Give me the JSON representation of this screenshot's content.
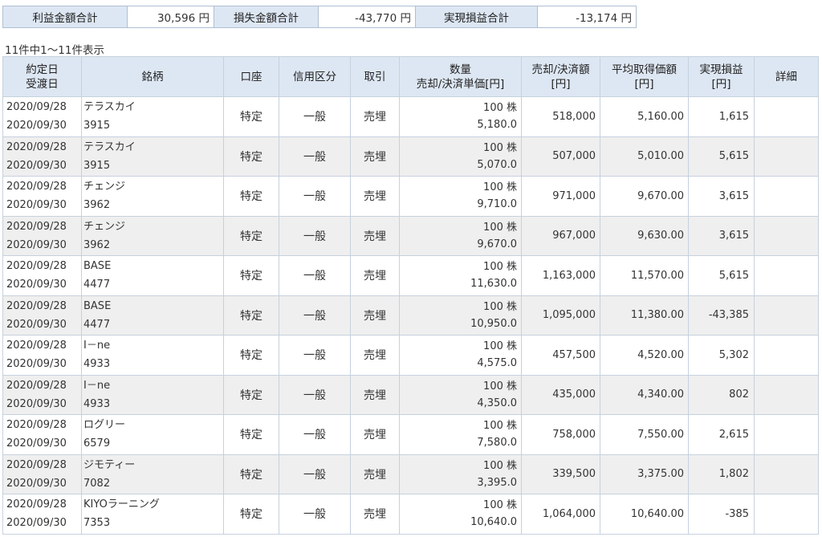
{
  "summary": {
    "profit_label": "利益金額合計",
    "profit_value": "30,596 円",
    "loss_label": "損失金額合計",
    "loss_value": "-43,770 円",
    "realized_label": "実現損益合計",
    "realized_value": "-13,174 円"
  },
  "count_text": "11件中1～11件表示",
  "headers": {
    "date": [
      "約定日",
      "受渡日"
    ],
    "brand": "銘柄",
    "account": "口座",
    "credit": "信用区分",
    "trade": "取引",
    "qty": [
      "数量",
      "売却/決済単価[円]"
    ],
    "amount": [
      "売却/決済額",
      "[円]"
    ],
    "avg": [
      "平均取得価額",
      "[円]"
    ],
    "pl": [
      "実現損益",
      "[円]"
    ],
    "detail": "詳細"
  },
  "rows": [
    {
      "trade_date": "2020/09/28",
      "settle_date": "2020/09/30",
      "name": "テラスカイ",
      "code": "3915",
      "account": "特定",
      "credit": "一般",
      "trade": "売埋",
      "qty": "100 株",
      "price": "5,180.0",
      "amount": "518,000",
      "avg": "5,160.00",
      "pl": "1,615"
    },
    {
      "trade_date": "2020/09/28",
      "settle_date": "2020/09/30",
      "name": "テラスカイ",
      "code": "3915",
      "account": "特定",
      "credit": "一般",
      "trade": "売埋",
      "qty": "100 株",
      "price": "5,070.0",
      "amount": "507,000",
      "avg": "5,010.00",
      "pl": "5,615"
    },
    {
      "trade_date": "2020/09/28",
      "settle_date": "2020/09/30",
      "name": "チェンジ",
      "code": "3962",
      "account": "特定",
      "credit": "一般",
      "trade": "売埋",
      "qty": "100 株",
      "price": "9,710.0",
      "amount": "971,000",
      "avg": "9,670.00",
      "pl": "3,615"
    },
    {
      "trade_date": "2020/09/28",
      "settle_date": "2020/09/30",
      "name": "チェンジ",
      "code": "3962",
      "account": "特定",
      "credit": "一般",
      "trade": "売埋",
      "qty": "100 株",
      "price": "9,670.0",
      "amount": "967,000",
      "avg": "9,630.00",
      "pl": "3,615"
    },
    {
      "trade_date": "2020/09/28",
      "settle_date": "2020/09/30",
      "name": "BASE",
      "code": "4477",
      "account": "特定",
      "credit": "一般",
      "trade": "売埋",
      "qty": "100 株",
      "price": "11,630.0",
      "amount": "1,163,000",
      "avg": "11,570.00",
      "pl": "5,615"
    },
    {
      "trade_date": "2020/09/28",
      "settle_date": "2020/09/30",
      "name": "BASE",
      "code": "4477",
      "account": "特定",
      "credit": "一般",
      "trade": "売埋",
      "qty": "100 株",
      "price": "10,950.0",
      "amount": "1,095,000",
      "avg": "11,380.00",
      "pl": "-43,385"
    },
    {
      "trade_date": "2020/09/28",
      "settle_date": "2020/09/30",
      "name": "I－ne",
      "code": "4933",
      "account": "特定",
      "credit": "一般",
      "trade": "売埋",
      "qty": "100 株",
      "price": "4,575.0",
      "amount": "457,500",
      "avg": "4,520.00",
      "pl": "5,302"
    },
    {
      "trade_date": "2020/09/28",
      "settle_date": "2020/09/30",
      "name": "I－ne",
      "code": "4933",
      "account": "特定",
      "credit": "一般",
      "trade": "売埋",
      "qty": "100 株",
      "price": "4,350.0",
      "amount": "435,000",
      "avg": "4,340.00",
      "pl": "802"
    },
    {
      "trade_date": "2020/09/28",
      "settle_date": "2020/09/30",
      "name": "ログリー",
      "code": "6579",
      "account": "特定",
      "credit": "一般",
      "trade": "売埋",
      "qty": "100 株",
      "price": "7,580.0",
      "amount": "758,000",
      "avg": "7,550.00",
      "pl": "2,615"
    },
    {
      "trade_date": "2020/09/28",
      "settle_date": "2020/09/30",
      "name": "ジモティー",
      "code": "7082",
      "account": "特定",
      "credit": "一般",
      "trade": "売埋",
      "qty": "100 株",
      "price": "3,395.0",
      "amount": "339,500",
      "avg": "3,375.00",
      "pl": "1,802"
    },
    {
      "trade_date": "2020/09/28",
      "settle_date": "2020/09/30",
      "name": "KIYOラーニング",
      "code": "7353",
      "account": "特定",
      "credit": "一般",
      "trade": "売埋",
      "qty": "100 株",
      "price": "10,640.0",
      "amount": "1,064,000",
      "avg": "10,640.00",
      "pl": "-385"
    }
  ]
}
